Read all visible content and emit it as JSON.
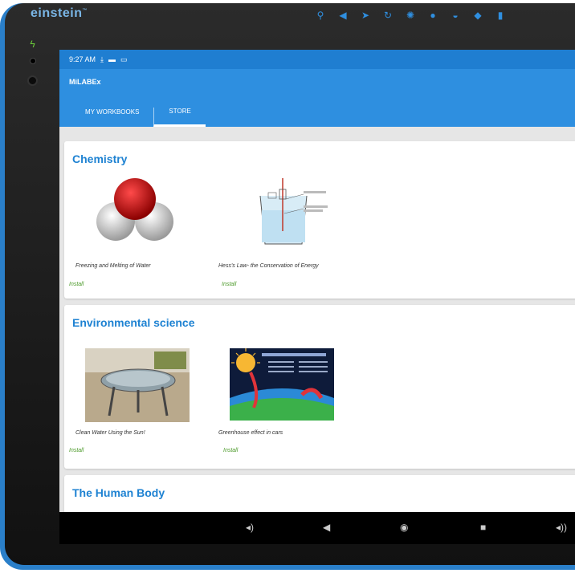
{
  "device": {
    "brand": "einstein"
  },
  "status_bar": {
    "time": "9:27 AM",
    "icons": [
      "download-icon",
      "photo-icon",
      "card-icon"
    ]
  },
  "app": {
    "title": "MiLABEx"
  },
  "tabs": [
    {
      "label": "MY WORKBOOKS",
      "active": false
    },
    {
      "label": "STORE",
      "active": true
    }
  ],
  "sections": [
    {
      "title": "Chemistry",
      "items": [
        {
          "name": "Freezing and Melting of Water",
          "action": "Install",
          "thumb": "water-molecule-image"
        },
        {
          "name": "Hess's Law- the Conservation of Energy",
          "action": "Install",
          "thumb": "beaker-diagram-image"
        }
      ]
    },
    {
      "title": "Environmental science",
      "items": [
        {
          "name": "Clean Water Using the Sun!",
          "action": "Install",
          "thumb": "solar-still-photo"
        },
        {
          "name": "Greenhouse effect in cars",
          "action": "Install",
          "thumb": "greenhouse-poster-image"
        }
      ]
    },
    {
      "title": "The Human Body",
      "items": []
    }
  ],
  "colors": {
    "accent": "#2e8fe0",
    "section_title": "#1e82d2",
    "install": "#4c9a2a",
    "device_frame": "#2a7fc9"
  }
}
